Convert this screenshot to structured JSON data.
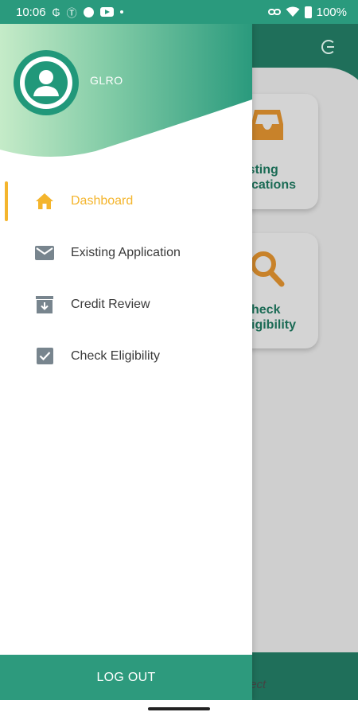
{
  "status_bar": {
    "time": "10:06",
    "battery": "100%"
  },
  "background_app": {
    "cards": [
      {
        "label_line1": "isting",
        "label_line2": "lications"
      },
      {
        "label_line1": "heck",
        "label_line2": "igibility"
      }
    ],
    "footer_text": "fect"
  },
  "drawer": {
    "user_name": "GLRO",
    "items": [
      {
        "label": "Dashboard",
        "icon": "home-icon",
        "active": true
      },
      {
        "label": "Existing Application",
        "icon": "mail-icon",
        "active": false
      },
      {
        "label": "Credit Review",
        "icon": "archive-download-icon",
        "active": false
      },
      {
        "label": "Check Eligibility",
        "icon": "checkbox-icon",
        "active": false
      }
    ],
    "logout_label": "LOG OUT"
  },
  "colors": {
    "accent": "#2d9a7d",
    "active": "#f4b52d",
    "icon_gray": "#78858e",
    "card_orange": "#c8822a"
  }
}
